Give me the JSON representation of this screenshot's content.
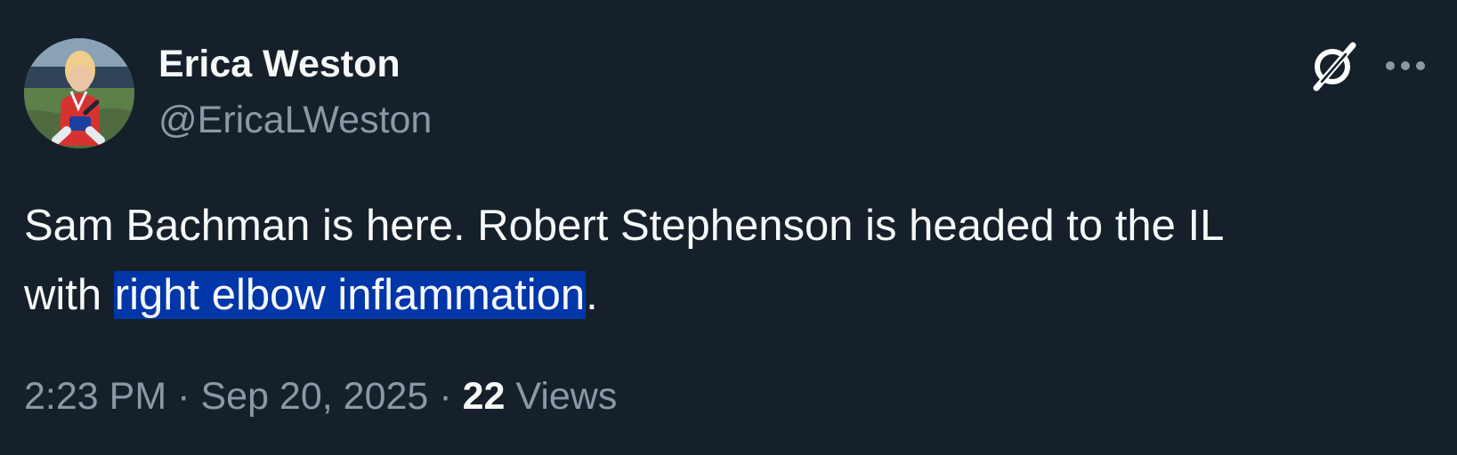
{
  "author": {
    "name": "Erica Weston",
    "handle": "@EricaLWeston"
  },
  "icons": {
    "grok": "grok-icon",
    "more": "more-icon",
    "avatar": "avatar"
  },
  "tweet": {
    "text_before": "Sam Bachman is here. Robert Stephenson is headed to the IL\nwith ",
    "highlighted": "right elbow inflammation",
    "text_after": "."
  },
  "meta": {
    "time": "2:23 PM",
    "separator": "·",
    "date": "Sep 20, 2025",
    "views_count": "22",
    "views_label": "Views"
  },
  "colors": {
    "background": "#15202b",
    "primary_text": "#f7f9f9",
    "secondary_text": "#8b98a5",
    "highlight": "#0036a8"
  }
}
